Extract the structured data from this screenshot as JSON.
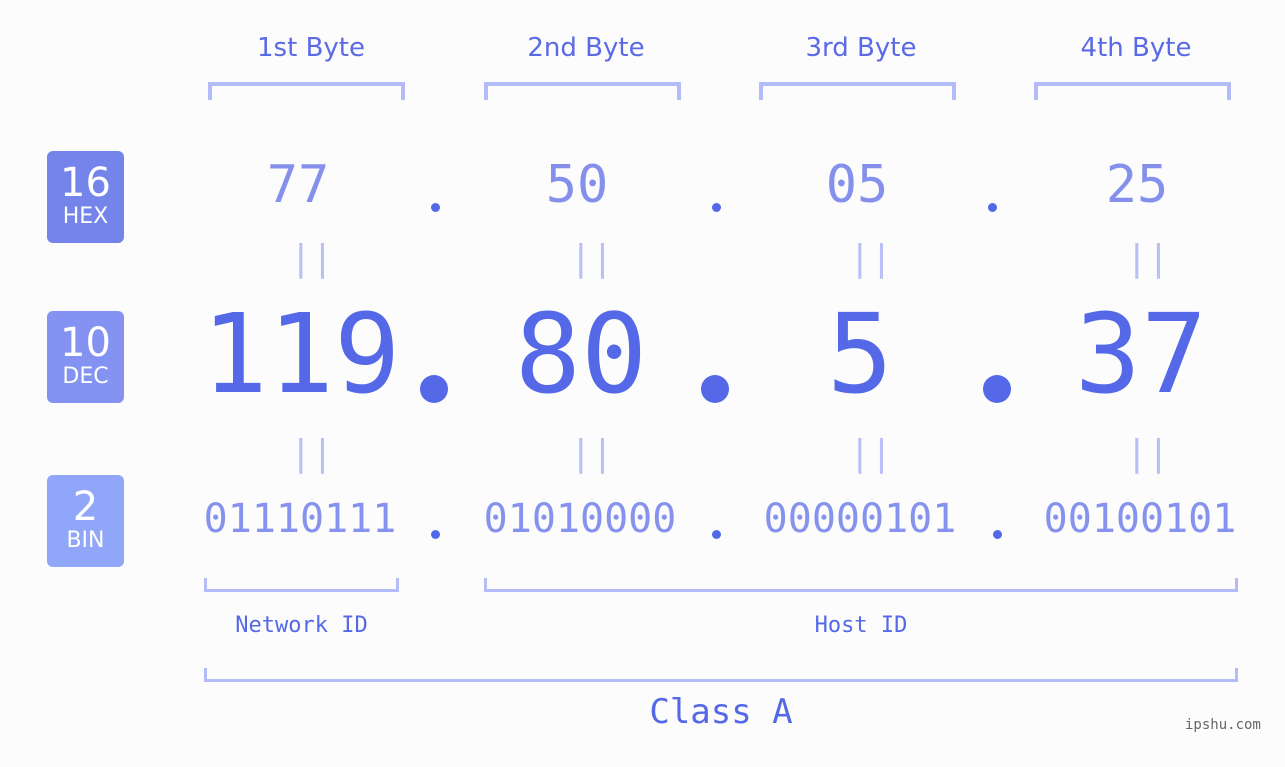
{
  "byte_headers": [
    "1st Byte",
    "2nd Byte",
    "3rd Byte",
    "4th Byte"
  ],
  "rows": {
    "hex": {
      "badge_number": "16",
      "badge_name": "HEX",
      "badge_color": "#7484ea",
      "values": [
        "77",
        "50",
        "05",
        "25"
      ]
    },
    "dec": {
      "badge_number": "10",
      "badge_name": "DEC",
      "badge_color": "#8493f1",
      "values": [
        "119",
        "80",
        "5",
        "37"
      ]
    },
    "bin": {
      "badge_number": "2",
      "badge_name": "BIN",
      "badge_color": "#90a6f9",
      "values": [
        "01110111",
        "01010000",
        "00000101",
        "00100101"
      ]
    }
  },
  "separator": ".",
  "equals_symbol": "||",
  "network_label": "Network ID",
  "host_label": "Host ID",
  "class_label": "Class A",
  "watermark": "ipshu.com",
  "colors": {
    "accent": "#5468e8",
    "bracket": "#b3bcf8",
    "background": "#fbfcfb"
  }
}
